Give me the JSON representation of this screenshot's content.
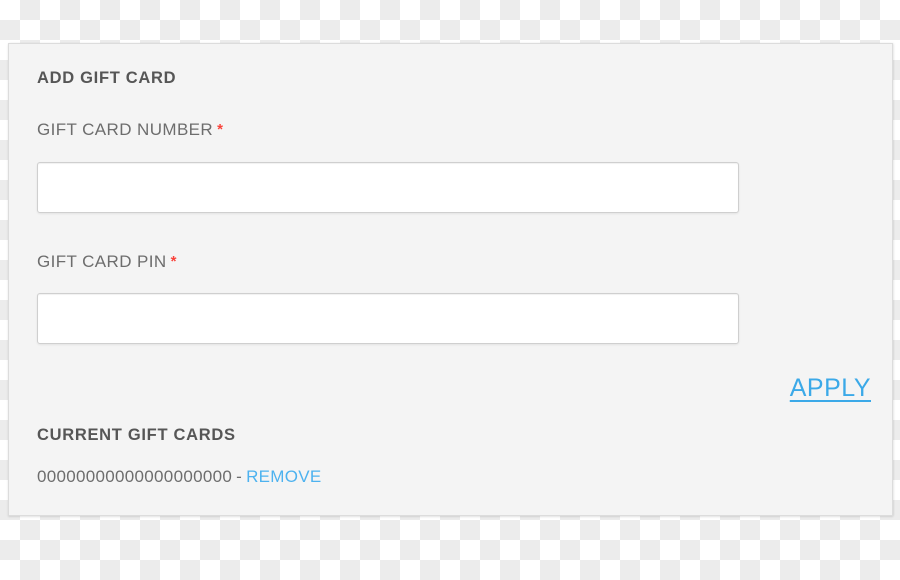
{
  "panel": {
    "add_section_title": "ADD GIFT CARD",
    "current_section_title": "CURRENT GIFT CARDS",
    "fields": {
      "gift_card_number": {
        "label": "GIFT CARD NUMBER",
        "required_marker": "*",
        "value": "",
        "placeholder": ""
      },
      "gift_card_pin": {
        "label": "GIFT CARD PIN",
        "required_marker": "*",
        "value": "",
        "placeholder": ""
      }
    },
    "apply_label": "APPLY",
    "current_cards": [
      {
        "number": "00000000000000000000",
        "separator": "-",
        "remove_label": "REMOVE"
      }
    ]
  },
  "colors": {
    "panel_background": "#f4f4f4",
    "panel_border": "#dcdcdc",
    "heading_text": "#565656",
    "label_text": "#6d6d6d",
    "required_star": "#f9423a",
    "apply_link": "#3ba9e8",
    "remove_link": "#4db2ef",
    "input_background": "#ffffff",
    "input_border": "#cfcfcf",
    "checker_light": "#ffffff",
    "checker_dark": "#ececec"
  }
}
